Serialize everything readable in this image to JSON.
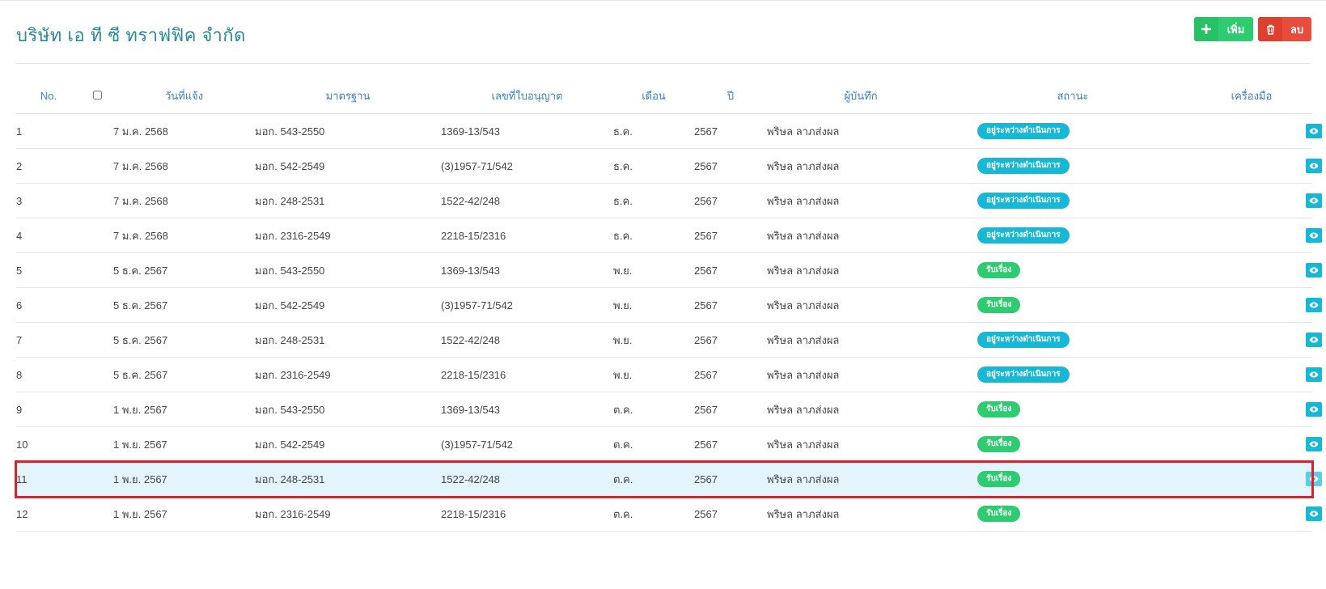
{
  "page": {
    "title": "บริษัท เอ ที ซี ทราฟฟิค จำกัด"
  },
  "toolbar": {
    "add_label": "เพิ่ม",
    "add_icon": "plus-icon",
    "delete_label": "ลบ",
    "delete_icon": "trash-icon"
  },
  "colors": {
    "title": "#2b8a9a",
    "header_text": "#3a7fc1",
    "add_button": "#2ecc71",
    "delete_button": "#e74c3c",
    "status_in_progress": "#17b8d6",
    "status_received": "#2ecc71",
    "view_button": "#17b8d6",
    "selected_row_bg": "#e3f4fc",
    "selected_row_border": "#e02028"
  },
  "table": {
    "headers": {
      "no": "No.",
      "date": "วันที่แจ้ง",
      "standard": "มาตรฐาน",
      "license": "เลขที่ใบอนุญาต",
      "month": "เดือน",
      "year": "ปี",
      "recorder": "ผู้บันทึก",
      "status": "สถานะ",
      "tools": "เครื่องมือ"
    },
    "selected_row": 11,
    "rows": [
      {
        "no": "1",
        "date": "7 ม.ค. 2568",
        "standard": "มอก. 543-2550",
        "license": "1369-13/543",
        "month": "ธ.ค.",
        "year": "2567",
        "recorder": "พริษล ลาภส่งผล",
        "status": "อยู่ระหว่างดำเนินการ",
        "status_type": "in-progress"
      },
      {
        "no": "2",
        "date": "7 ม.ค. 2568",
        "standard": "มอก. 542-2549",
        "license": "(3)1957-71/542",
        "month": "ธ.ค.",
        "year": "2567",
        "recorder": "พริษล ลาภส่งผล",
        "status": "อยู่ระหว่างดำเนินการ",
        "status_type": "in-progress"
      },
      {
        "no": "3",
        "date": "7 ม.ค. 2568",
        "standard": "มอก. 248-2531",
        "license": "1522-42/248",
        "month": "ธ.ค.",
        "year": "2567",
        "recorder": "พริษล ลาภส่งผล",
        "status": "อยู่ระหว่างดำเนินการ",
        "status_type": "in-progress"
      },
      {
        "no": "4",
        "date": "7 ม.ค. 2568",
        "standard": "มอก. 2316-2549",
        "license": "2218-15/2316",
        "month": "ธ.ค.",
        "year": "2567",
        "recorder": "พริษล ลาภส่งผล",
        "status": "อยู่ระหว่างดำเนินการ",
        "status_type": "in-progress"
      },
      {
        "no": "5",
        "date": "5 ธ.ค. 2567",
        "standard": "มอก. 543-2550",
        "license": "1369-13/543",
        "month": "พ.ย.",
        "year": "2567",
        "recorder": "พริษล ลาภส่งผล",
        "status": "รับเรื่อง",
        "status_type": "received"
      },
      {
        "no": "6",
        "date": "5 ธ.ค. 2567",
        "standard": "มอก. 542-2549",
        "license": "(3)1957-71/542",
        "month": "พ.ย.",
        "year": "2567",
        "recorder": "พริษล ลาภส่งผล",
        "status": "รับเรื่อง",
        "status_type": "received"
      },
      {
        "no": "7",
        "date": "5 ธ.ค. 2567",
        "standard": "มอก. 248-2531",
        "license": "1522-42/248",
        "month": "พ.ย.",
        "year": "2567",
        "recorder": "พริษล ลาภส่งผล",
        "status": "อยู่ระหว่างดำเนินการ",
        "status_type": "in-progress"
      },
      {
        "no": "8",
        "date": "5 ธ.ค. 2567",
        "standard": "มอก. 2316-2549",
        "license": "2218-15/2316",
        "month": "พ.ย.",
        "year": "2567",
        "recorder": "พริษล ลาภส่งผล",
        "status": "อยู่ระหว่างดำเนินการ",
        "status_type": "in-progress"
      },
      {
        "no": "9",
        "date": "1 พ.ย. 2567",
        "standard": "มอก. 543-2550",
        "license": "1369-13/543",
        "month": "ต.ค.",
        "year": "2567",
        "recorder": "พริษล ลาภส่งผล",
        "status": "รับเรื่อง",
        "status_type": "received"
      },
      {
        "no": "10",
        "date": "1 พ.ย. 2567",
        "standard": "มอก. 542-2549",
        "license": "(3)1957-71/542",
        "month": "ต.ค.",
        "year": "2567",
        "recorder": "พริษล ลาภส่งผล",
        "status": "รับเรื่อง",
        "status_type": "received"
      },
      {
        "no": "11",
        "date": "1 พ.ย. 2567",
        "standard": "มอก. 248-2531",
        "license": "1522-42/248",
        "month": "ต.ค.",
        "year": "2567",
        "recorder": "พริษล ลาภส่งผล",
        "status": "รับเรื่อง",
        "status_type": "received"
      },
      {
        "no": "12",
        "date": "1 พ.ย. 2567",
        "standard": "มอก. 2316-2549",
        "license": "2218-15/2316",
        "month": "ต.ค.",
        "year": "2567",
        "recorder": "พริษล ลาภส่งผล",
        "status": "รับเรื่อง",
        "status_type": "received"
      }
    ],
    "view_icon": "eye-icon"
  }
}
